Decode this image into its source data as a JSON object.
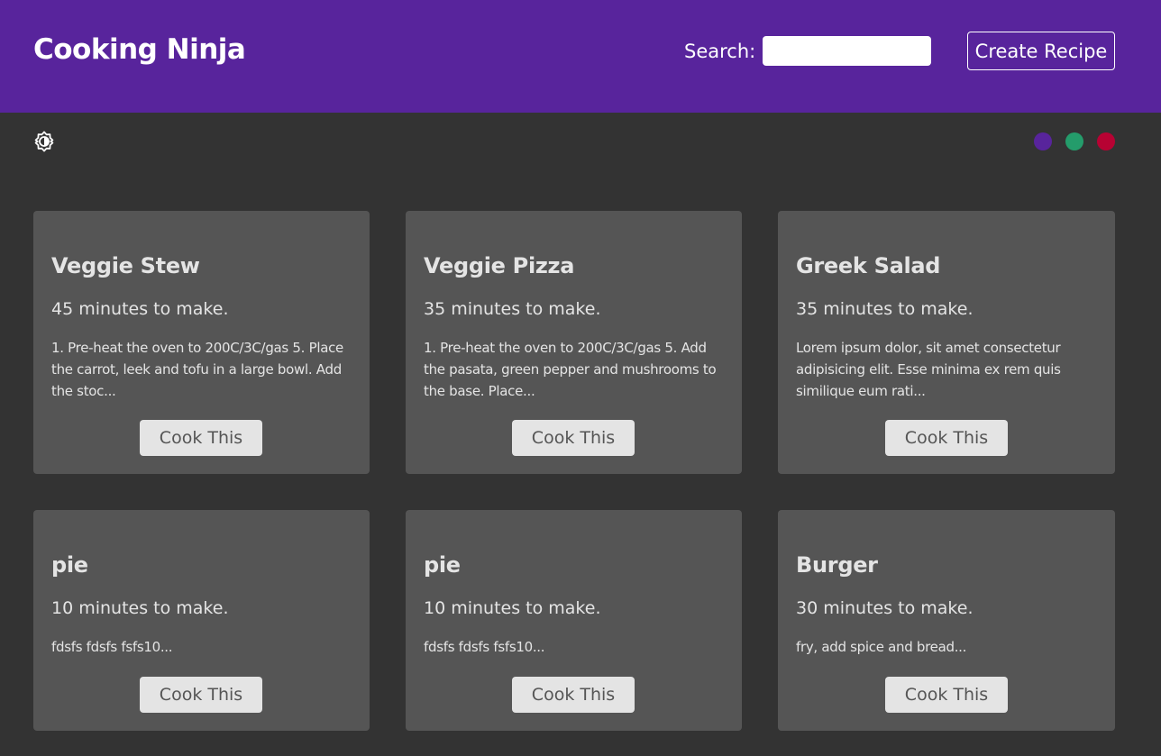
{
  "navbar": {
    "title": "Cooking Ninja",
    "search_label": "Search:",
    "search_value": "",
    "create_label": "Create Recipe"
  },
  "theme": {
    "mode_icon": "brightness-toggle-icon",
    "swatches": [
      "#58249c",
      "#249c6b",
      "#b70233"
    ]
  },
  "recipes": [
    {
      "title": "Veggie Stew",
      "time": "45 minutes to make.",
      "method": "1. Pre-heat the oven to 200C/3C/gas 5. Place the carrot, leek and tofu in a large bowl. Add the stoc...",
      "button": "Cook This"
    },
    {
      "title": "Veggie Pizza",
      "time": "35 minutes to make.",
      "method": "1. Pre-heat the oven to 200C/3C/gas 5. Add the pasata, green pepper and mushrooms to the base. Place...",
      "button": "Cook This"
    },
    {
      "title": "Greek Salad",
      "time": "35 minutes to make.",
      "method": "Lorem ipsum dolor, sit amet consectetur adipisicing elit. Esse minima ex rem quis similique eum rati...",
      "button": "Cook This"
    },
    {
      "title": "pie",
      "time": "10 minutes to make.",
      "method": "fdsfs fdsfs fsfs10...",
      "button": "Cook This"
    },
    {
      "title": "pie",
      "time": "10 minutes to make.",
      "method": "fdsfs fdsfs fsfs10...",
      "button": "Cook This"
    },
    {
      "title": "Burger",
      "time": "30 minutes to make.",
      "method": "fry, add spice and bread...",
      "button": "Cook This"
    }
  ]
}
